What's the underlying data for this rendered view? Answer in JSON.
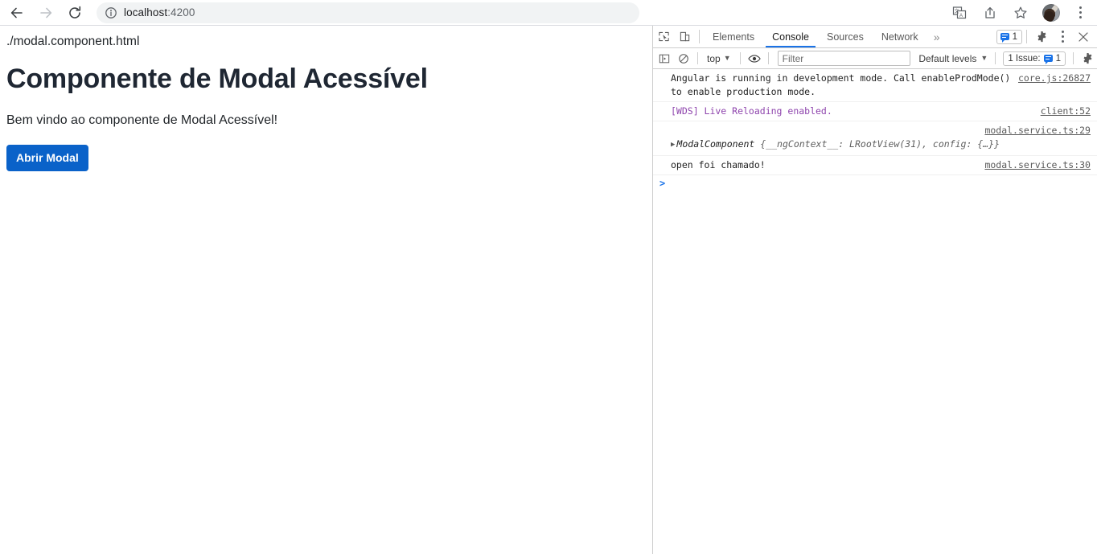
{
  "browser": {
    "back_label": "Back",
    "forward_label": "Forward",
    "reload_label": "Reload",
    "url_host": "localhost",
    "url_port": ":4200",
    "url_full": "localhost:4200",
    "icons": {
      "site_info": "info-icon",
      "translate": "translate-icon",
      "share": "share-icon",
      "bookmark": "star-icon",
      "profile": "avatar",
      "menu": "kebab-menu-icon"
    }
  },
  "page": {
    "filename": "./modal.component.html",
    "title": "Componente de Modal Acessível",
    "lede": "Bem vindo ao componente de Modal Acessível!",
    "button_label": "Abrir Modal",
    "button_color": "#0a62c9"
  },
  "devtools": {
    "tabs": [
      {
        "label": "Elements",
        "active": false
      },
      {
        "label": "Console",
        "active": true
      },
      {
        "label": "Sources",
        "active": false
      },
      {
        "label": "Network",
        "active": false
      }
    ],
    "more_tabs_label": "»",
    "message_count": "1",
    "icons": {
      "inspect": "inspect-element-icon",
      "device": "device-toolbar-icon",
      "settings": "gear-icon",
      "more": "kebab-menu-icon",
      "close": "close-icon",
      "sidebar": "console-sidebar-icon",
      "clear": "clear-console-icon",
      "eye": "live-expression-eye-icon"
    },
    "filterbar": {
      "context_label": "top",
      "filter_placeholder": "Filter",
      "filter_value": "",
      "levels_label": "Default levels",
      "issues_label": "1 Issue:",
      "issues_count": "1"
    },
    "messages": [
      {
        "type": "log",
        "text": "Angular is running in development mode. Call enableProdMode() to enable production mode.",
        "source": "core.js:26827"
      },
      {
        "type": "log",
        "text": "[WDS] Live Reloading enabled.",
        "source": "client:52"
      },
      {
        "type": "object",
        "class_name": "ModalComponent",
        "preview": " {__ngContext__: LRootView(31), config: {…}}",
        "source": "modal.service.ts:29"
      },
      {
        "type": "log",
        "text": "open foi chamado!",
        "source": "modal.service.ts:30"
      }
    ],
    "prompt_symbol": ">"
  }
}
